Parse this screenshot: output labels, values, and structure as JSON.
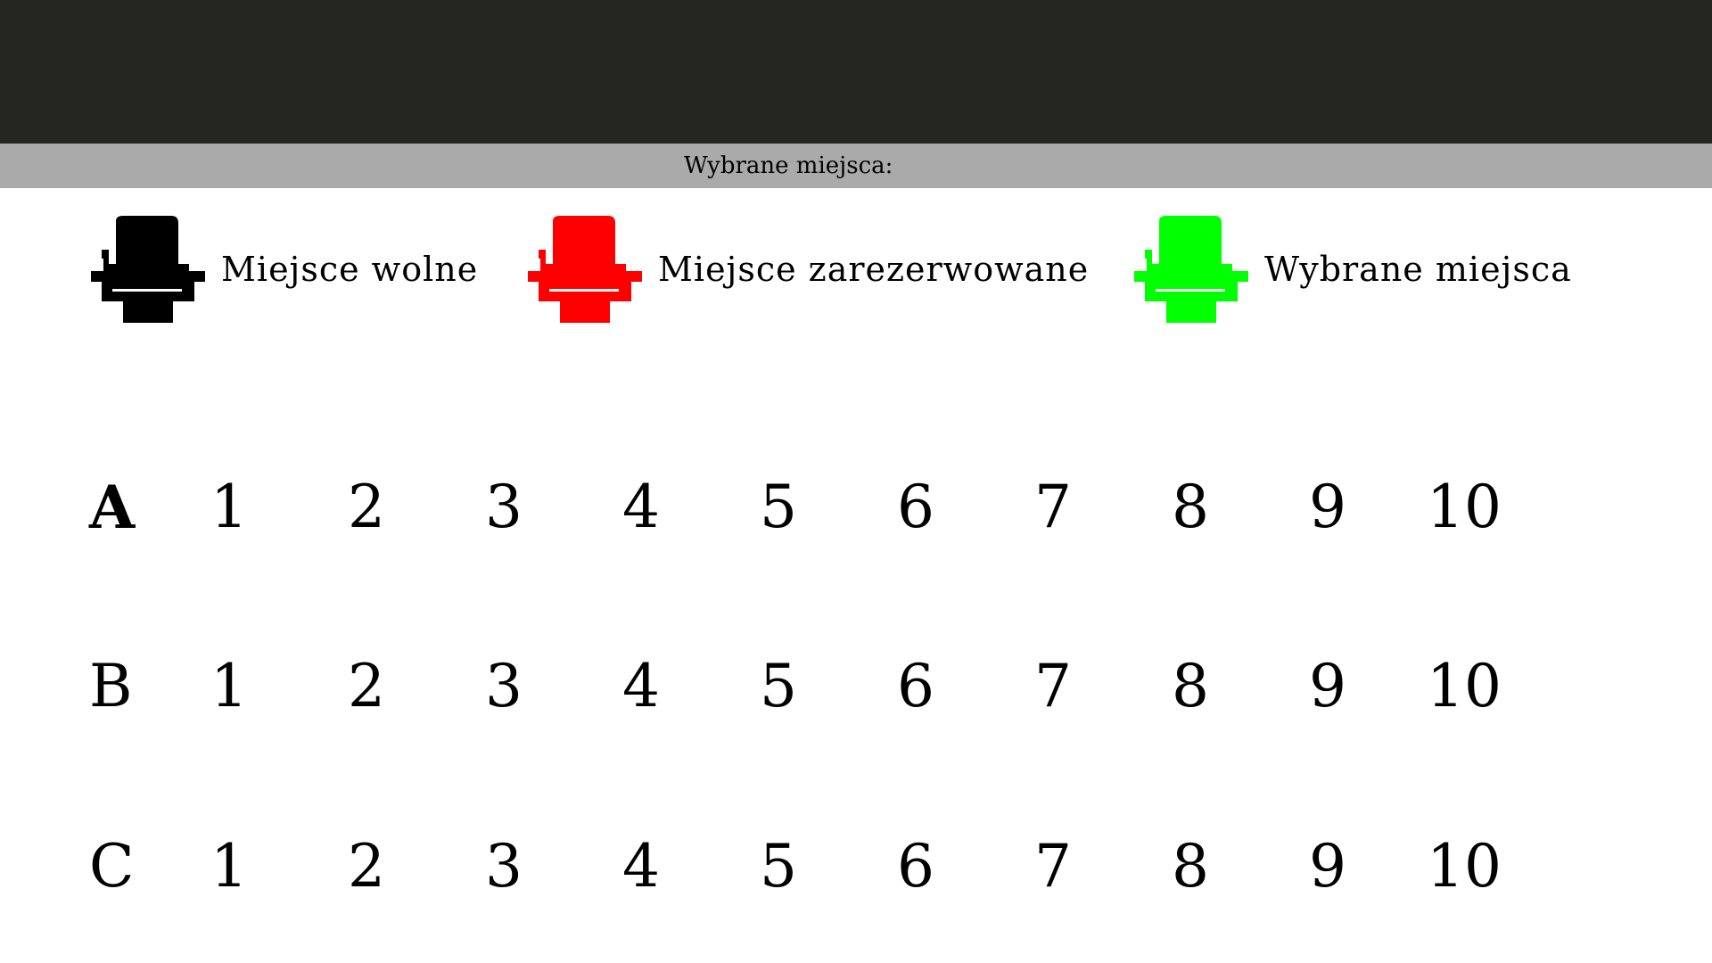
{
  "header": {
    "selected_label": "Wybrane miejsca:"
  },
  "legend": [
    {
      "label": "Miejsce wolne",
      "color": "#000000",
      "icon": "seat-icon"
    },
    {
      "label": "Miejsce zarezerwowane",
      "color": "#ff0000",
      "icon": "seat-icon"
    },
    {
      "label": "Wybrane miejsca",
      "color": "#00ff00",
      "icon": "seat-icon"
    }
  ],
  "seats": {
    "rows": [
      {
        "label": "A",
        "numbers": [
          "1",
          "2",
          "3",
          "4",
          "5",
          "6",
          "7",
          "8",
          "9",
          "10"
        ]
      },
      {
        "label": "B",
        "numbers": [
          "1",
          "2",
          "3",
          "4",
          "5",
          "6",
          "7",
          "8",
          "9",
          "10"
        ]
      },
      {
        "label": "C",
        "numbers": [
          "1",
          "2",
          "3",
          "4",
          "5",
          "6",
          "7",
          "8",
          "9",
          "10"
        ]
      }
    ]
  }
}
